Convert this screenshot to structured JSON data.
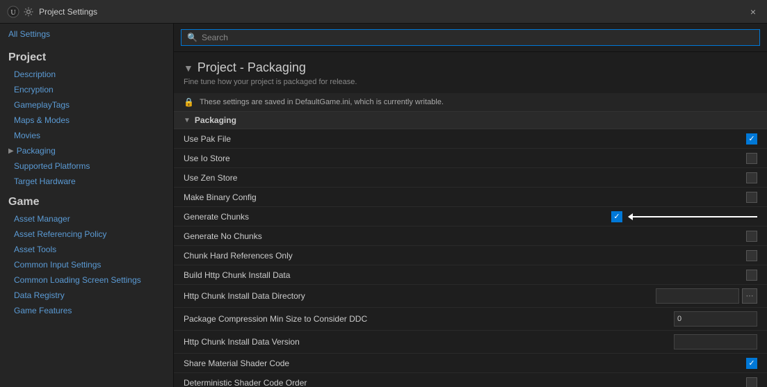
{
  "titleBar": {
    "title": "Project Settings",
    "closeLabel": "×"
  },
  "sidebar": {
    "allSettings": "All Settings",
    "sections": [
      {
        "title": "Project",
        "items": [
          {
            "id": "description",
            "label": "Description",
            "hasArrow": false
          },
          {
            "id": "encryption",
            "label": "Encryption",
            "hasArrow": false
          },
          {
            "id": "gameplaytags",
            "label": "GameplayTags",
            "hasArrow": false
          },
          {
            "id": "maps-modes",
            "label": "Maps & Modes",
            "hasArrow": false
          },
          {
            "id": "movies",
            "label": "Movies",
            "hasArrow": false
          },
          {
            "id": "packaging",
            "label": "Packaging",
            "hasArrow": true,
            "active": true
          },
          {
            "id": "supported-platforms",
            "label": "Supported Platforms",
            "hasArrow": false
          },
          {
            "id": "target-hardware",
            "label": "Target Hardware",
            "hasArrow": false
          }
        ]
      },
      {
        "title": "Game",
        "items": [
          {
            "id": "asset-manager",
            "label": "Asset Manager",
            "hasArrow": false
          },
          {
            "id": "asset-referencing-policy",
            "label": "Asset Referencing Policy",
            "hasArrow": false
          },
          {
            "id": "asset-tools",
            "label": "Asset Tools",
            "hasArrow": false
          },
          {
            "id": "common-input-settings",
            "label": "Common Input Settings",
            "hasArrow": false
          },
          {
            "id": "common-loading-screen-settings",
            "label": "Common Loading Screen Settings",
            "hasArrow": false
          },
          {
            "id": "data-registry",
            "label": "Data Registry",
            "hasArrow": false
          },
          {
            "id": "game-features",
            "label": "Game Features",
            "hasArrow": false
          }
        ]
      }
    ]
  },
  "search": {
    "placeholder": "Search"
  },
  "content": {
    "heading": "Project - Packaging",
    "subheading": "Fine tune how your project is packaged for release.",
    "infoBar": "These settings are saved in DefaultGame.ini, which is currently writable.",
    "packagingGroup": {
      "label": "Packaging",
      "rows": [
        {
          "id": "use-pak-file",
          "label": "Use Pak File",
          "type": "checkbox",
          "checked": true,
          "annotated": false
        },
        {
          "id": "use-io-store",
          "label": "Use Io Store",
          "type": "checkbox",
          "checked": false,
          "annotated": false
        },
        {
          "id": "use-zen-store",
          "label": "Use Zen Store",
          "type": "checkbox",
          "checked": false,
          "annotated": false
        },
        {
          "id": "make-binary-config",
          "label": "Make Binary Config",
          "type": "checkbox",
          "checked": false,
          "annotated": false
        },
        {
          "id": "generate-chunks",
          "label": "Generate Chunks",
          "type": "checkbox",
          "checked": true,
          "annotated": true
        },
        {
          "id": "generate-no-chunks",
          "label": "Generate No Chunks",
          "type": "checkbox",
          "checked": false,
          "annotated": false
        },
        {
          "id": "chunk-hard-references-only",
          "label": "Chunk Hard References Only",
          "type": "checkbox",
          "checked": false,
          "annotated": false
        },
        {
          "id": "build-http-chunk-install-data",
          "label": "Build Http Chunk Install Data",
          "type": "checkbox",
          "checked": false,
          "annotated": false
        },
        {
          "id": "http-chunk-install-data-directory",
          "label": "Http Chunk Install Data Directory",
          "type": "text-ellipsis",
          "value": ""
        },
        {
          "id": "package-compression-min-size",
          "label": "Package Compression Min Size to Consider DDC",
          "type": "text",
          "value": "0"
        },
        {
          "id": "http-chunk-install-data-version",
          "label": "Http Chunk Install Data Version",
          "type": "text",
          "value": ""
        },
        {
          "id": "share-material-shader-code",
          "label": "Share Material Shader Code",
          "type": "checkbox",
          "checked": true,
          "annotated": false
        },
        {
          "id": "deterministic-shader-code-order",
          "label": "Deterministic Shader Code Order",
          "type": "checkbox",
          "checked": false,
          "annotated": false
        }
      ]
    }
  },
  "icons": {
    "search": "🔍",
    "lock": "🔒",
    "ue": "◈",
    "arrow_right": "▶",
    "arrow_down": "▼",
    "arrow_left_annotation": "←"
  }
}
